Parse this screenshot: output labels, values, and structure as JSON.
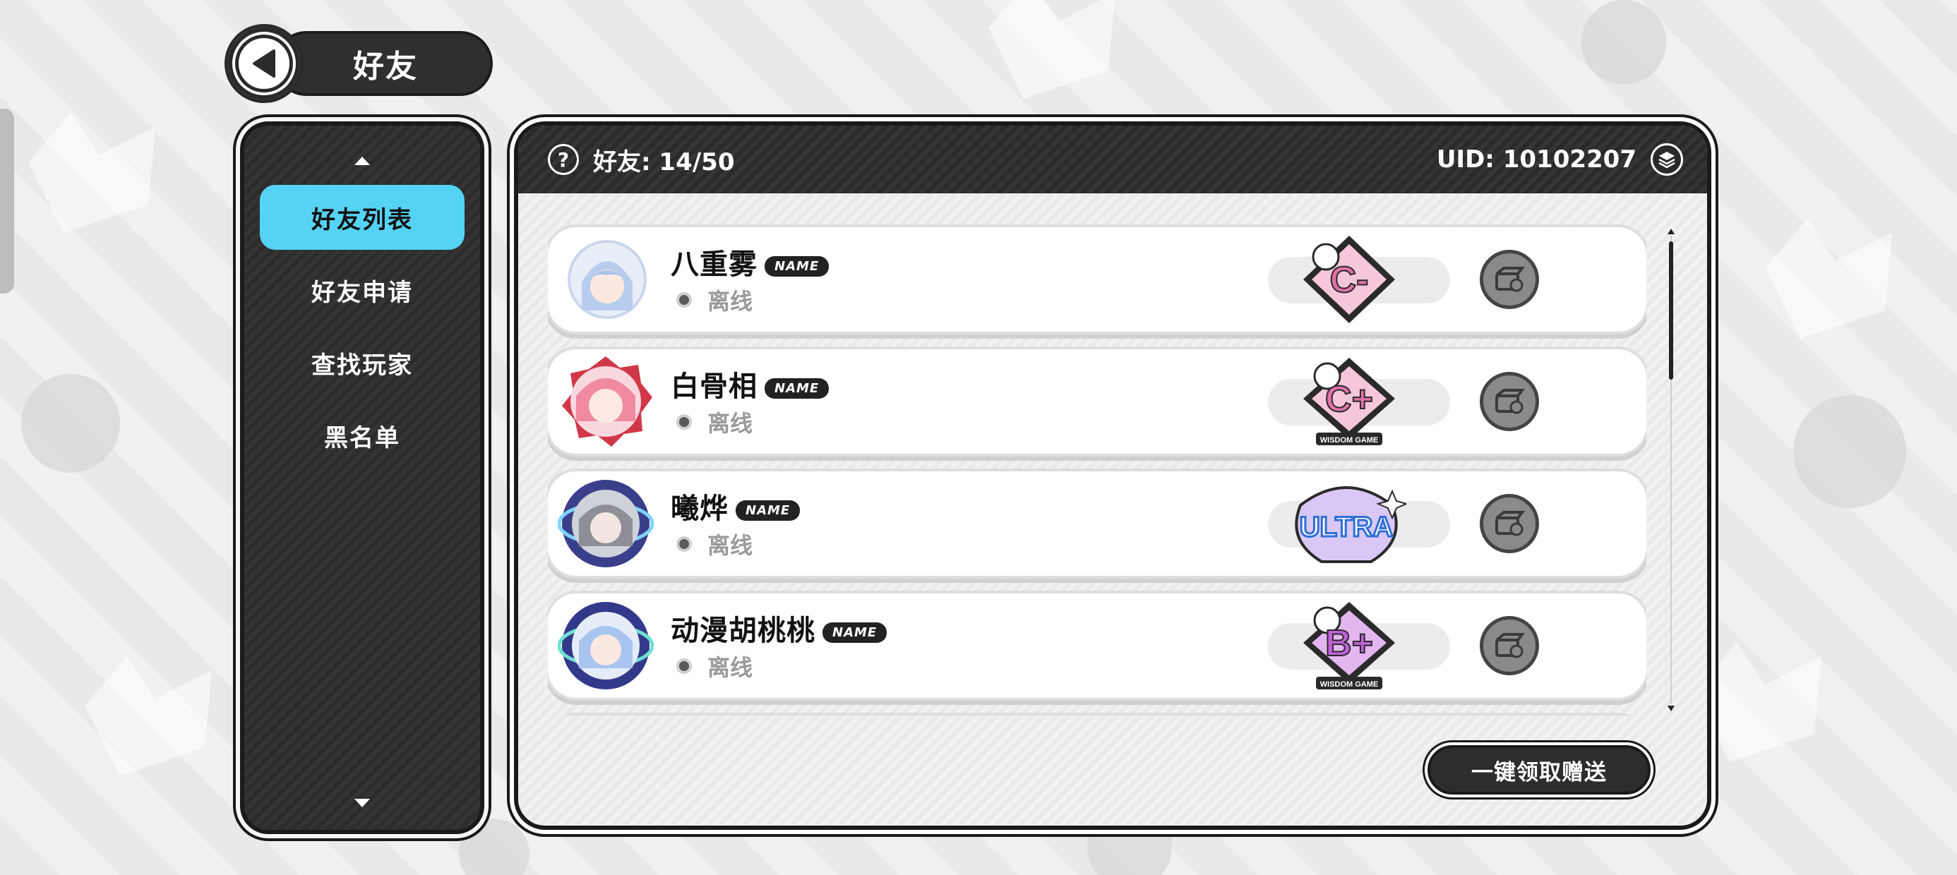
{
  "header": {
    "title": "好友"
  },
  "sidebar": {
    "items": [
      {
        "label": "好友列表",
        "active": true
      },
      {
        "label": "好友申请",
        "active": false
      },
      {
        "label": "查找玩家",
        "active": false
      },
      {
        "label": "黑名单",
        "active": false
      }
    ]
  },
  "main": {
    "friend_count": "好友: 14/50",
    "uid": "UID: 10102207",
    "claim_all_label": "一键领取赠送",
    "friends": [
      {
        "name": "八重雾",
        "badge": "NAME",
        "status": "离线",
        "rank": "C-",
        "rank_subtitle": ""
      },
      {
        "name": "白骨相",
        "badge": "NAME",
        "status": "离线",
        "rank": "C+",
        "rank_subtitle": "WISDOM GAME"
      },
      {
        "name": "曦烨",
        "badge": "NAME",
        "status": "离线",
        "rank": "ULTRA",
        "rank_subtitle": ""
      },
      {
        "name": "动漫胡桃桃",
        "badge": "NAME",
        "status": "离线",
        "rank": "B+",
        "rank_subtitle": "WISDOM GAME"
      }
    ]
  },
  "colors": {
    "accent": "#55d3f5",
    "dark": "#2c2c2c",
    "rank_pink": "#e889b6",
    "rank_purple": "#c060d8"
  },
  "icons": [
    "back-arrow-icon",
    "up-arrow-icon",
    "down-arrow-icon",
    "help-icon",
    "layers-icon",
    "gift-icon",
    "status-dot-icon"
  ]
}
